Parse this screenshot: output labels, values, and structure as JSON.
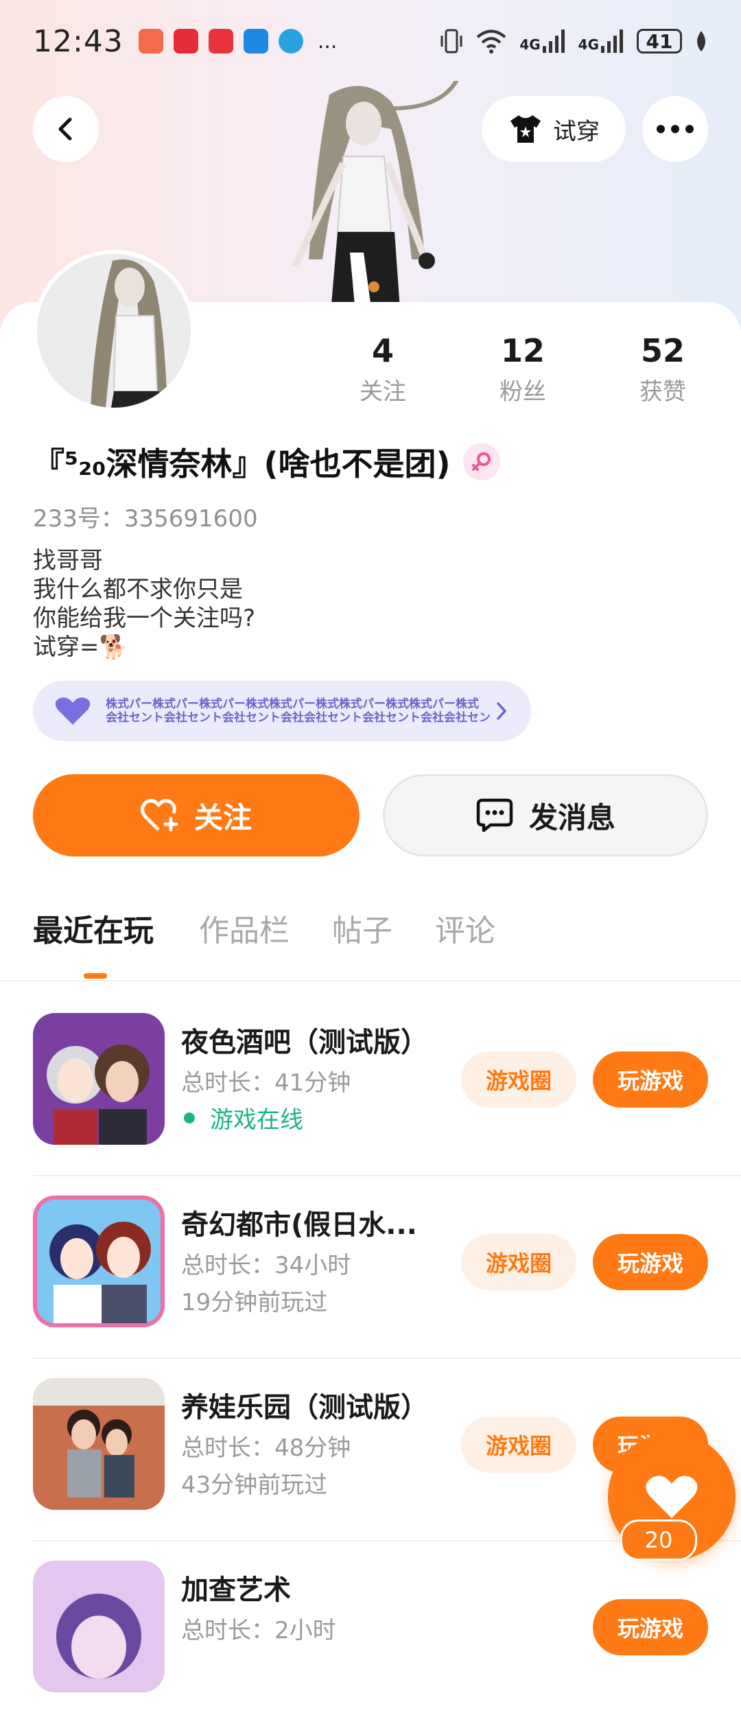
{
  "status_bar": {
    "time": "12:43",
    "app_icons": [
      {
        "name": "app-icon-1",
        "color": "#f36b4a"
      },
      {
        "name": "app-icon-huawei",
        "color": "#e52d3a"
      },
      {
        "name": "app-icon-3",
        "color": "#e8333b"
      },
      {
        "name": "app-icon-search",
        "color": "#1e88e5"
      },
      {
        "name": "app-icon-5",
        "color": "#29a3e0"
      }
    ],
    "more": "...",
    "network_1": "4G",
    "network_2": "4G",
    "battery": "41"
  },
  "header": {
    "tryon_label": "试穿"
  },
  "profile": {
    "stats": [
      {
        "value": "4",
        "label": "关注"
      },
      {
        "value": "12",
        "label": "粉丝"
      },
      {
        "value": "52",
        "label": "获赞"
      }
    ],
    "name": "『⁵₂₀深情奈林』(啥也不是团)",
    "uid": "233号：335691600",
    "bio": [
      "找哥哥",
      "我什么都不求你只是",
      "你能给我一个关注吗?",
      "试穿=🐕"
    ],
    "badge": {
      "line1": "株式パー株式パー株式パー株式株式パー株式株式パー株式株式パー株式",
      "line2": "会社セント会社セント会社セント会社会社セント会社セント会社会社セント会社"
    },
    "follow_label": "关注",
    "message_label": "发消息"
  },
  "tabs": [
    "最近在玩",
    "作品栏",
    "帖子",
    "评论"
  ],
  "games": [
    {
      "name": "夜色酒吧（测试版）",
      "duration": "总时长：41分钟",
      "status": "游戏在线",
      "online": true,
      "circle_label": "游戏圈",
      "play_label": "玩游戏"
    },
    {
      "name": "奇幻都市(假日水...",
      "duration": "总时长：34小时",
      "status": "19分钟前玩过",
      "online": false,
      "circle_label": "游戏圈",
      "play_label": "玩游戏"
    },
    {
      "name": "养娃乐园（测试版）",
      "duration": "总时长：48分钟",
      "status": "43分钟前玩过",
      "online": false,
      "circle_label": "游戏圈",
      "play_label": "玩游戏"
    },
    {
      "name": "加查艺术",
      "duration": "总时长：2小时",
      "status": "",
      "online": false,
      "circle_label": "",
      "play_label": "玩游戏"
    }
  ],
  "like_fab": {
    "count": "20"
  },
  "colors": {
    "accent": "#ff7a14",
    "online": "#1fb386",
    "badge_bg": "#ecebfb",
    "badge_text": "#6b63c9"
  }
}
